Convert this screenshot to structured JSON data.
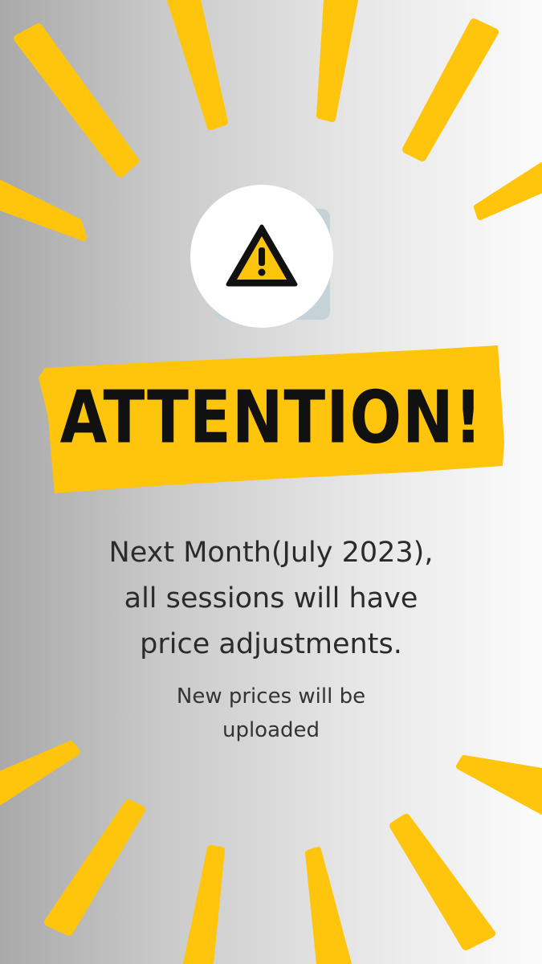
{
  "colors": {
    "accent_yellow": "#FFC40C",
    "text_dark": "#111111",
    "background_left": "#a9a9a9",
    "background_right": "#fbfbfb",
    "badge_white": "#ffffff"
  },
  "icon": {
    "name": "warning-icon"
  },
  "banner": {
    "headline": "ATTENTION!"
  },
  "message": {
    "line1": "Next Month(July 2023),",
    "line2": "all sessions will have",
    "line3": "price adjustments."
  },
  "note": {
    "line1": "New prices will be",
    "line2": "uploaded"
  }
}
